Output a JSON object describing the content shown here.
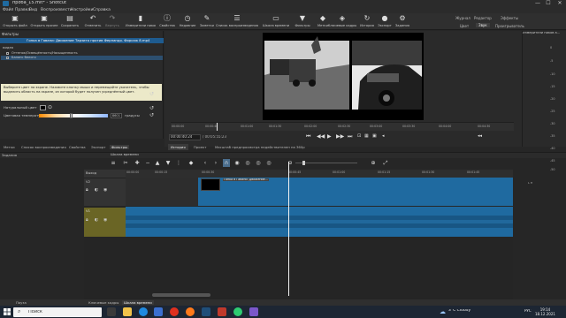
{
  "window": {
    "title": "проба_15.mlt* - Shotcut",
    "minimize": "—",
    "maximize": "☐",
    "close": "✕"
  },
  "menu": [
    "Файл",
    "Правка",
    "Вид",
    "Воспроизвести",
    "Настройки",
    "Справка"
  ],
  "toolbar": [
    {
      "label": "Открыть файл",
      "icon": "folder-icon",
      "glyph": "▣"
    },
    {
      "label": "Открыть прочее",
      "icon": "folder-open-icon",
      "glyph": "▣"
    },
    {
      "label": "Сохранить",
      "icon": "save-icon",
      "glyph": "▤"
    },
    {
      "label": "Отменить",
      "icon": "undo-icon",
      "glyph": "↶"
    },
    {
      "label": "Вернуть",
      "icon": "redo-icon",
      "glyph": "↷"
    },
    {
      "label": "Измерители пиков",
      "icon": "meter-icon",
      "glyph": "▮"
    },
    {
      "label": "Свойства",
      "icon": "info-icon",
      "glyph": "ⓘ"
    },
    {
      "label": "Недавние",
      "icon": "recent-icon",
      "glyph": "◷"
    },
    {
      "label": "Заметки",
      "icon": "notes-icon",
      "glyph": "✎"
    },
    {
      "label": "Список воспроизведения",
      "icon": "playlist-icon",
      "glyph": "☰"
    },
    {
      "label": "Шкала времени",
      "icon": "timeline-icon",
      "glyph": "▭"
    },
    {
      "label": "Фильтры",
      "icon": "filter-icon",
      "glyph": "▼"
    },
    {
      "label": "Метки",
      "icon": "markers-icon",
      "glyph": "◆"
    },
    {
      "label": "Ключевые кадры",
      "icon": "keyframes-icon",
      "glyph": "◈"
    },
    {
      "label": "История",
      "icon": "history-icon",
      "glyph": "↻"
    },
    {
      "label": "Экспорт",
      "icon": "export-icon",
      "glyph": "●"
    },
    {
      "label": "Задания",
      "icon": "jobs-icon",
      "glyph": "⚙"
    }
  ],
  "layouts_top": [
    "Журнал",
    "Редактор",
    "Эффекты"
  ],
  "layouts_bottom": [
    "Цвет",
    "Звук",
    "Проигрыватель"
  ],
  "filters": {
    "panel_title": "Фильтры",
    "clip_name": "Гонка в Гавани: Движение Тарзито против Фернандо. Форсаж 8.mp4",
    "section": "Видео",
    "items": [
      {
        "label": "Оттенок/Освещённость/Насыщенность",
        "checked": true,
        "selected": false
      },
      {
        "label": "Баланс белого",
        "checked": true,
        "selected": true
      }
    ],
    "hint": "Выберите цвет на экране. Нажмите кнопку мыши и перемещайте указатель, чтобы выделить область на экране, из которой будет получен усреднённый цвет.",
    "natural_color_label": "Натуральный цвет",
    "temperature_label": "Цветовая температура",
    "temperature_value": "8601",
    "temperature_unit": "градусы",
    "temperature_level": 0.47
  },
  "player": {
    "ruler_ticks": [
      "00:00:00",
      "00:00:40",
      "00:01:00",
      "00:01:30",
      "00:02:00",
      "00:02:30",
      "00:03:00",
      "00:03:30",
      "00:04:00",
      "00:04:30"
    ],
    "timecode": "00:00:40:24",
    "duration": "/ 00:05:55:23",
    "tabs": [
      "История",
      "Проект",
      "Масштаб предпросмотра недействителен на 360р"
    ]
  },
  "meter": {
    "title": "Измерители пиков а...",
    "scale": [
      "0",
      "-5",
      "-10",
      "-15",
      "-20",
      "-25",
      "-30",
      "-35",
      "-40",
      "-45",
      "-50"
    ],
    "lr": "L  R"
  },
  "bottom_tabs": [
    "Метки",
    "Список воспроизведения",
    "Свойства",
    "Экспорт",
    "Фильтры"
  ],
  "timeline": {
    "header": "Шкала времени",
    "jobs": "Задания",
    "output": "Выход",
    "ticks": [
      "00:00:00",
      "00:00:15",
      "00:00:30",
      "00:00:45",
      "00:01:00",
      "00:01:15",
      "00:01:30",
      "00:01:45",
      "00:02:00"
    ],
    "tracks": [
      {
        "name": "V2"
      },
      {
        "name": "V1"
      }
    ],
    "clip_v2": "Гонка в Гавани: Движение..."
  },
  "statusbar": {
    "left": "Пауза",
    "tabs": [
      "Ключевые кадры",
      "Шкала времени"
    ]
  },
  "taskbar": {
    "search_placeholder": "Поиск",
    "weather": "3°C  Cloudy",
    "lang": "РУС",
    "time": "19:14",
    "date": "18.12.2021",
    "colors": {
      "accent": "#1f6aa0",
      "v1track": "#6a6525",
      "selected": "#2d4f6e"
    }
  }
}
